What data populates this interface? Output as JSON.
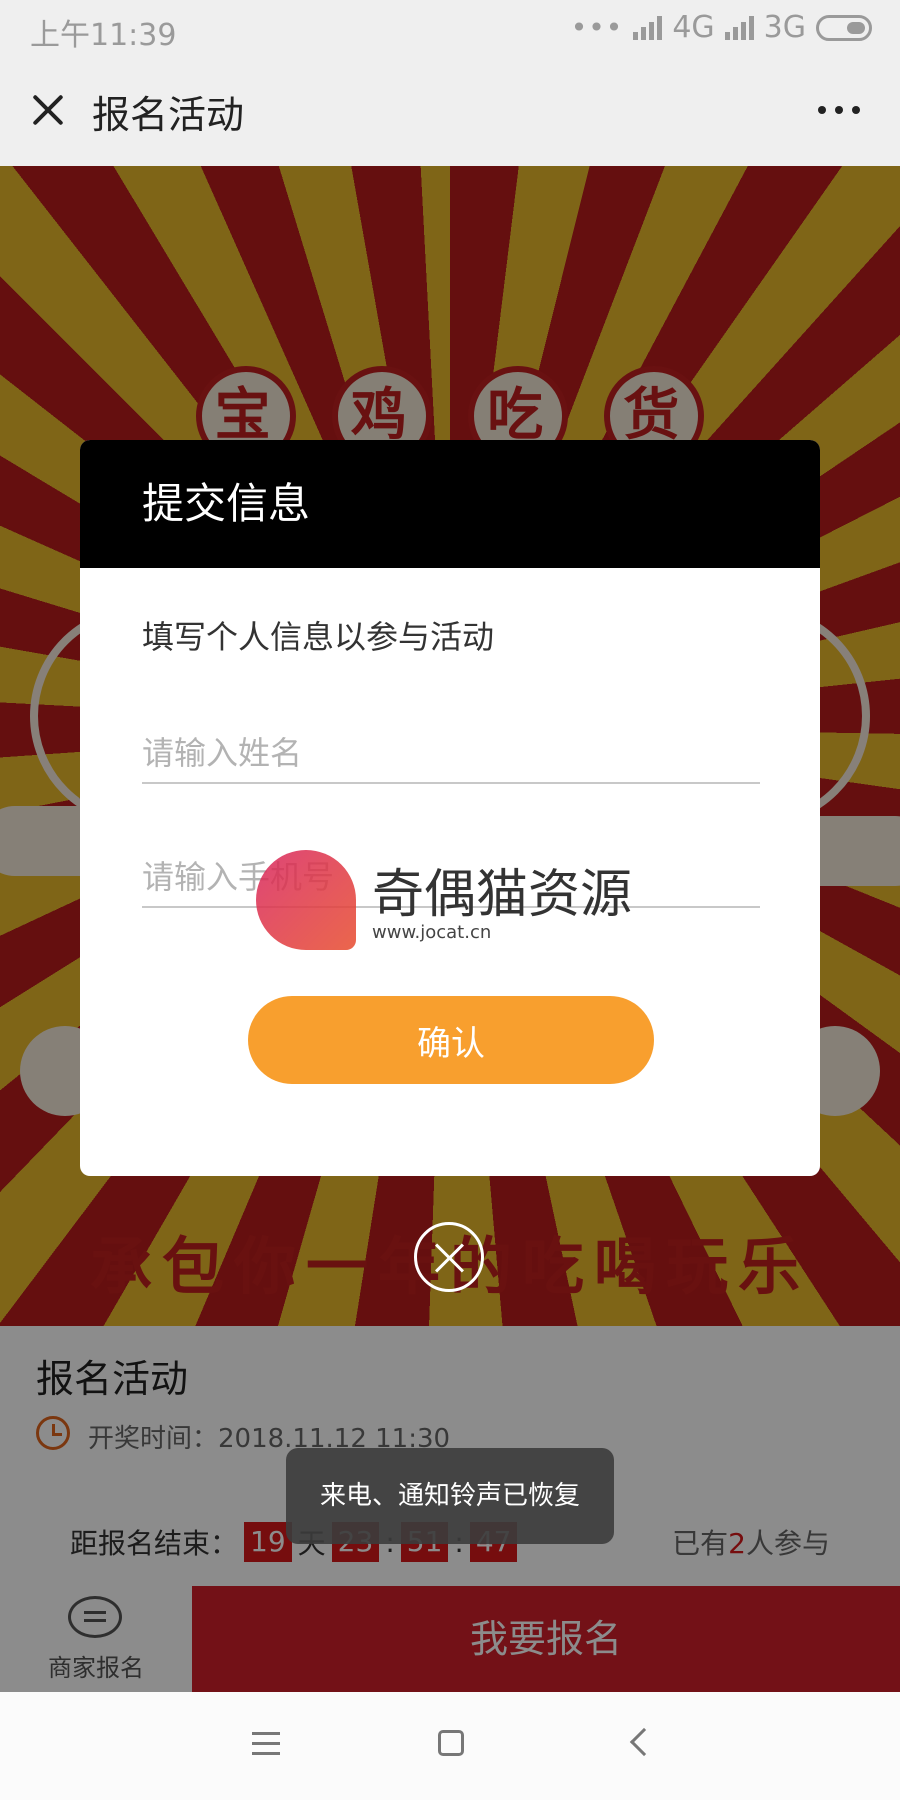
{
  "status_bar": {
    "time": "上午11:39",
    "network_1": "4G",
    "network_2": "3G"
  },
  "title_bar": {
    "title": "报名活动"
  },
  "banner": {
    "headline_chars": [
      "宝",
      "鸡",
      "吃",
      "货"
    ],
    "slogan": "承包你一年的吃喝玩乐"
  },
  "info": {
    "activity_name": "报名活动",
    "draw_time_label": "开奖时间：2018.11.12 11:30",
    "countdown_label": "距报名结束：",
    "countdown": {
      "days": "19",
      "day_unit": "天",
      "hours": "23",
      "minutes": "51",
      "seconds": "47",
      "sep": ":"
    },
    "joined_prefix": "已有",
    "joined_count": "2",
    "joined_suffix": "人参与"
  },
  "action_bar": {
    "merchant_label": "商家报名",
    "signup_label": "我要报名"
  },
  "modal": {
    "title": "提交信息",
    "description": "填写个人信息以参与活动",
    "name_placeholder": "请输入姓名",
    "phone_placeholder": "请输入手机号",
    "confirm_label": "确认"
  },
  "toast": {
    "message": "来电、通知铃声已恢复"
  },
  "watermark": {
    "brand": "奇偶猫资源",
    "site": "www.jocat.cn"
  },
  "colors": {
    "accent_orange": "#f89f2e",
    "signup_red": "#d11f2b",
    "modal_header": "#000000"
  }
}
